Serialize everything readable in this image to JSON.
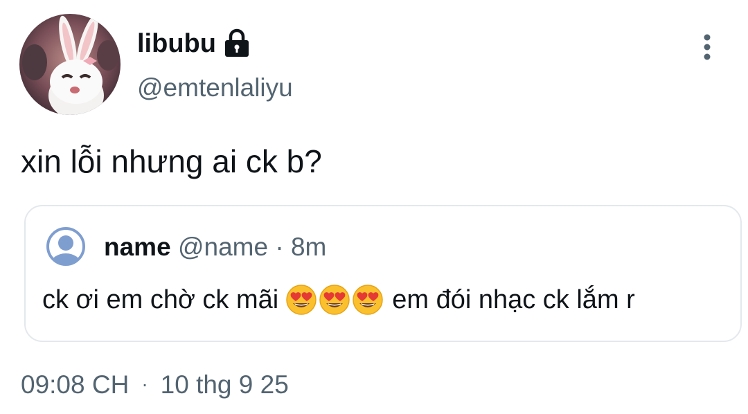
{
  "author": {
    "display_name": "libubu",
    "handle": "@emtenlaliyu",
    "lock_icon": "lock-icon",
    "avatar_icon": "white-rabbit-avatar"
  },
  "tweet": {
    "text": "xin lỗi nhưng ai ck b?",
    "time": "09:08 CH",
    "separator": "·",
    "date": "10 thg 9 25"
  },
  "quoted": {
    "name": "name",
    "handle": "@name",
    "separator": " · ",
    "age": "8m",
    "text_before": "ck ơi em chờ ck mãi",
    "emoji_icon": "heart-eyes-emoji",
    "text_after": "em đói nhạc ck lắm r"
  },
  "colors": {
    "text": "#0f1419",
    "secondary": "#536471",
    "border": "#e3e8ec",
    "default_avatar": "#7f9ed0"
  }
}
